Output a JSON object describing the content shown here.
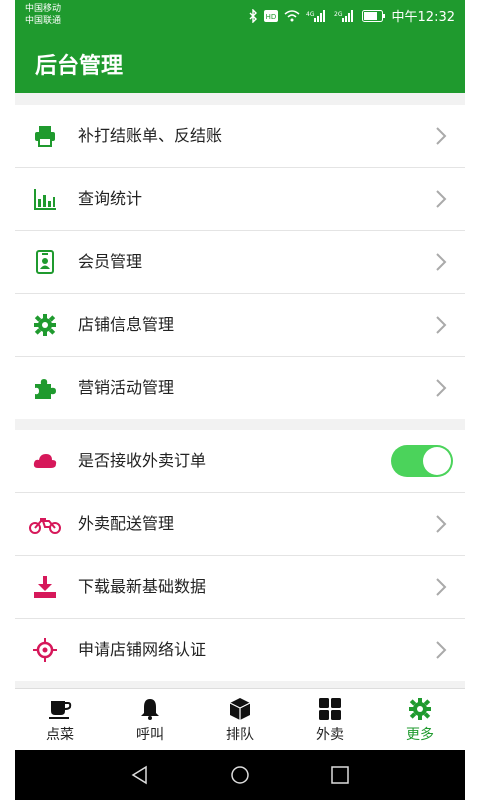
{
  "status_bar": {
    "carrier1": "中国移动",
    "carrier2": "中国联通",
    "time": "中午12:32",
    "icons": [
      "bluetooth-icon",
      "hd-icon",
      "wifi-icon",
      "signal-4g-icon",
      "signal-2g-icon",
      "battery-icon"
    ]
  },
  "header": {
    "title": "后台管理"
  },
  "group1": {
    "items": [
      {
        "label": "补打结账单、反结账",
        "icon": "printer-icon"
      },
      {
        "label": "查询统计",
        "icon": "bar-chart-icon"
      },
      {
        "label": "会员管理",
        "icon": "member-card-icon"
      },
      {
        "label": "店铺信息管理",
        "icon": "gear-icon"
      },
      {
        "label": "营销活动管理",
        "icon": "puzzle-icon"
      }
    ]
  },
  "group2": {
    "items": [
      {
        "label": "是否接收外卖订单",
        "icon": "cloud-icon",
        "toggle": true
      },
      {
        "label": "外卖配送管理",
        "icon": "motorcycle-icon"
      },
      {
        "label": "下载最新基础数据",
        "icon": "download-icon"
      },
      {
        "label": "申请店铺网络认证",
        "icon": "target-icon"
      }
    ]
  },
  "tabs": [
    {
      "label": "点菜",
      "icon": "coffee-cup-icon"
    },
    {
      "label": "呼叫",
      "icon": "bell-icon"
    },
    {
      "label": "排队",
      "icon": "box-icon"
    },
    {
      "label": "外卖",
      "icon": "grid-icon"
    },
    {
      "label": "更多",
      "icon": "gear-icon",
      "active": true
    }
  ],
  "colors": {
    "primary": "#1f9a2e",
    "accent_red": "#d6185a",
    "toggle_on": "#4bd35b"
  }
}
